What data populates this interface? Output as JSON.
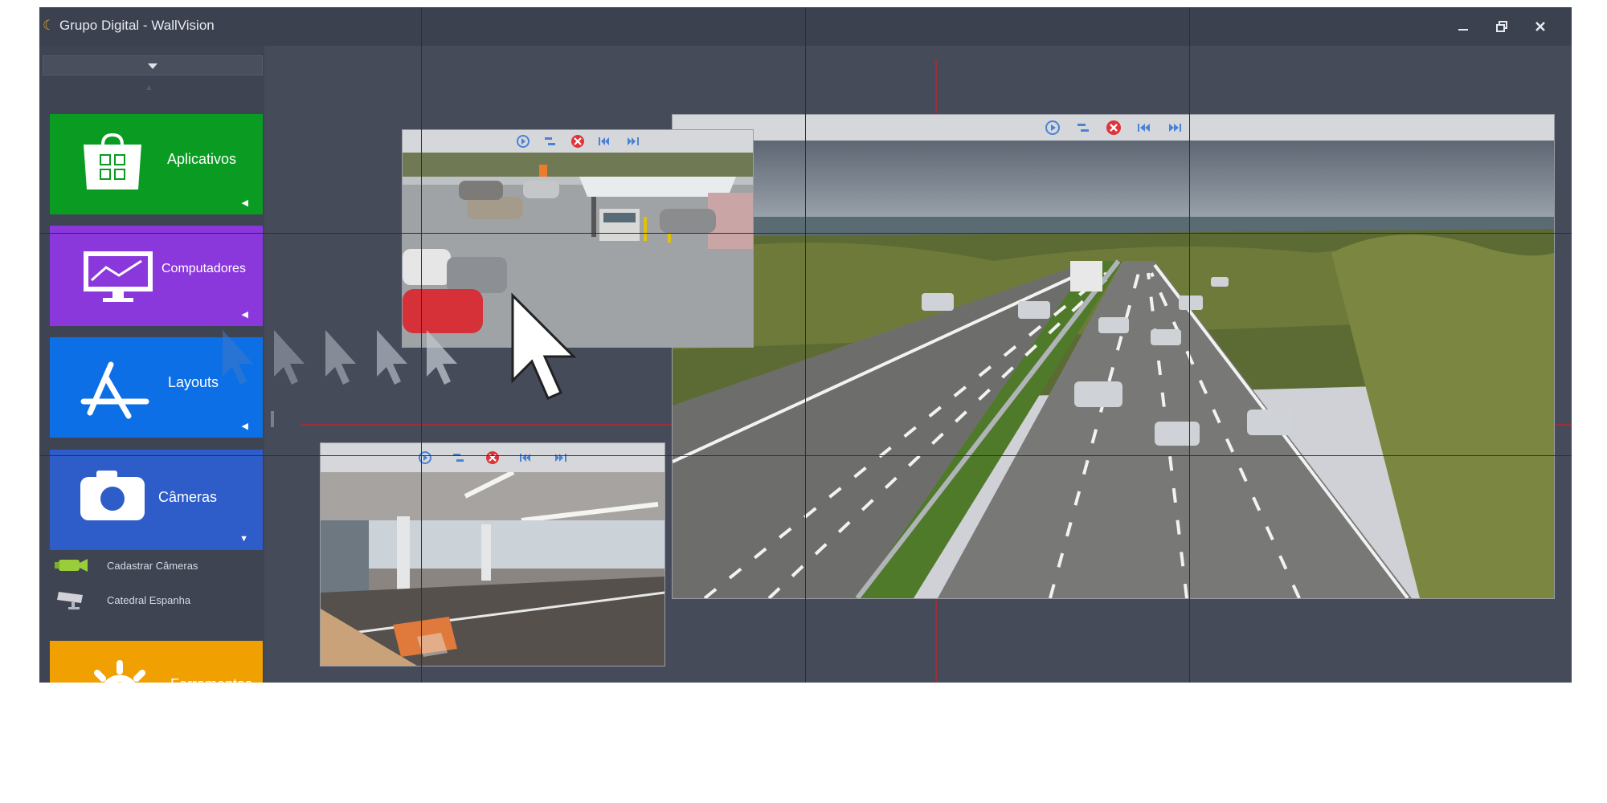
{
  "window": {
    "title": "Grupo Digital - WallVision",
    "controls": [
      "minimize-icon",
      "restore-icon",
      "close-icon"
    ]
  },
  "sidebar": {
    "tiles": [
      {
        "label": "Aplicativos",
        "icon": "windows-store-icon",
        "color": "#0a9b22"
      },
      {
        "label": "Computadores",
        "icon": "monitor-icon",
        "color": "#8a38dc"
      },
      {
        "label": "Layouts",
        "icon": "app-store-icon",
        "color": "#0d6fe5"
      },
      {
        "label": "Câmeras",
        "icon": "camera-icon",
        "color": "#2e5cc9"
      },
      {
        "label": "Ferramentas",
        "icon": "gear-icon",
        "color": "#f0a000"
      }
    ],
    "camera_items": [
      {
        "label": "Cadastrar Câmeras",
        "icon": "add-camera-icon"
      },
      {
        "label": "Catedral Espanha",
        "icon": "cctv-camera-icon"
      }
    ]
  },
  "camera_windows": [
    {
      "name": "parking-lot",
      "scene": "parking lot with cars and toll booth"
    },
    {
      "name": "parking-garage",
      "scene": "indoor parking garage"
    },
    {
      "name": "highway",
      "scene": "multi-lane highway with traffic"
    }
  ],
  "camera_toolbar": [
    "play-icon",
    "layout-icon",
    "close-icon",
    "previous-icon",
    "next-icon"
  ],
  "colors": {
    "window_bg": "#464b5a",
    "titlebar": "#3c4150",
    "grid_red": "#9c2f3b"
  }
}
